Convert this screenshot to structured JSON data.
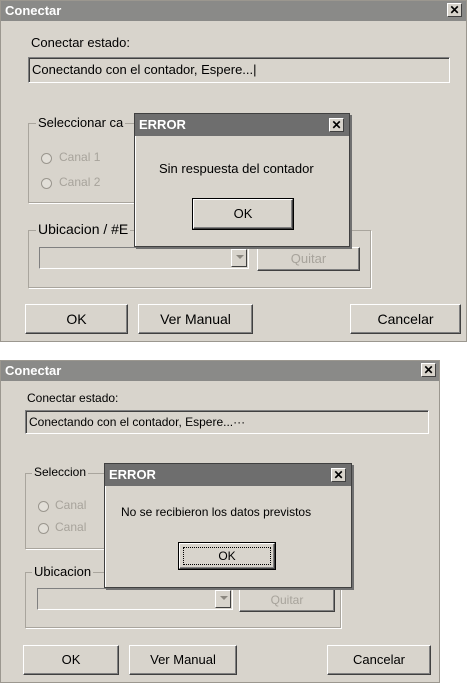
{
  "windows": [
    {
      "title": "Conectar",
      "close_glyph": "✕",
      "status_label": "Conectar estado:",
      "status_value": "Conectando con el contador, Espere...|",
      "select_group_label": "Seleccionar ca",
      "radio_1": "Canal 1",
      "radio_2": "Canal 2",
      "location_group_label": "Ubicacion / #E",
      "remove_button": "Quitar",
      "ok_button": "OK",
      "manual_button": "Ver Manual",
      "cancel_button": "Cancelar",
      "error": {
        "title": "ERROR",
        "message": "Sin respuesta del contador",
        "ok_button": "OK"
      }
    },
    {
      "title": "Conectar",
      "close_glyph": "✕",
      "status_label": "Conectar estado:",
      "status_value": "Conectando con el contador, Espere...···",
      "select_group_label": "Seleccion",
      "radio_1": "Canal",
      "radio_2": "Canal",
      "location_group_label": "Ubicacion",
      "remove_button": "Quitar",
      "ok_button": "OK",
      "manual_button": "Ver Manual",
      "cancel_button": "Cancelar",
      "error": {
        "title": "ERROR",
        "message": "No se recibieron los datos previstos",
        "ok_button": "OK"
      }
    }
  ],
  "colors": {
    "window_background": "#d8d4cc",
    "title_bar": "#8a8a88",
    "disabled_text": "#a7a39b"
  }
}
